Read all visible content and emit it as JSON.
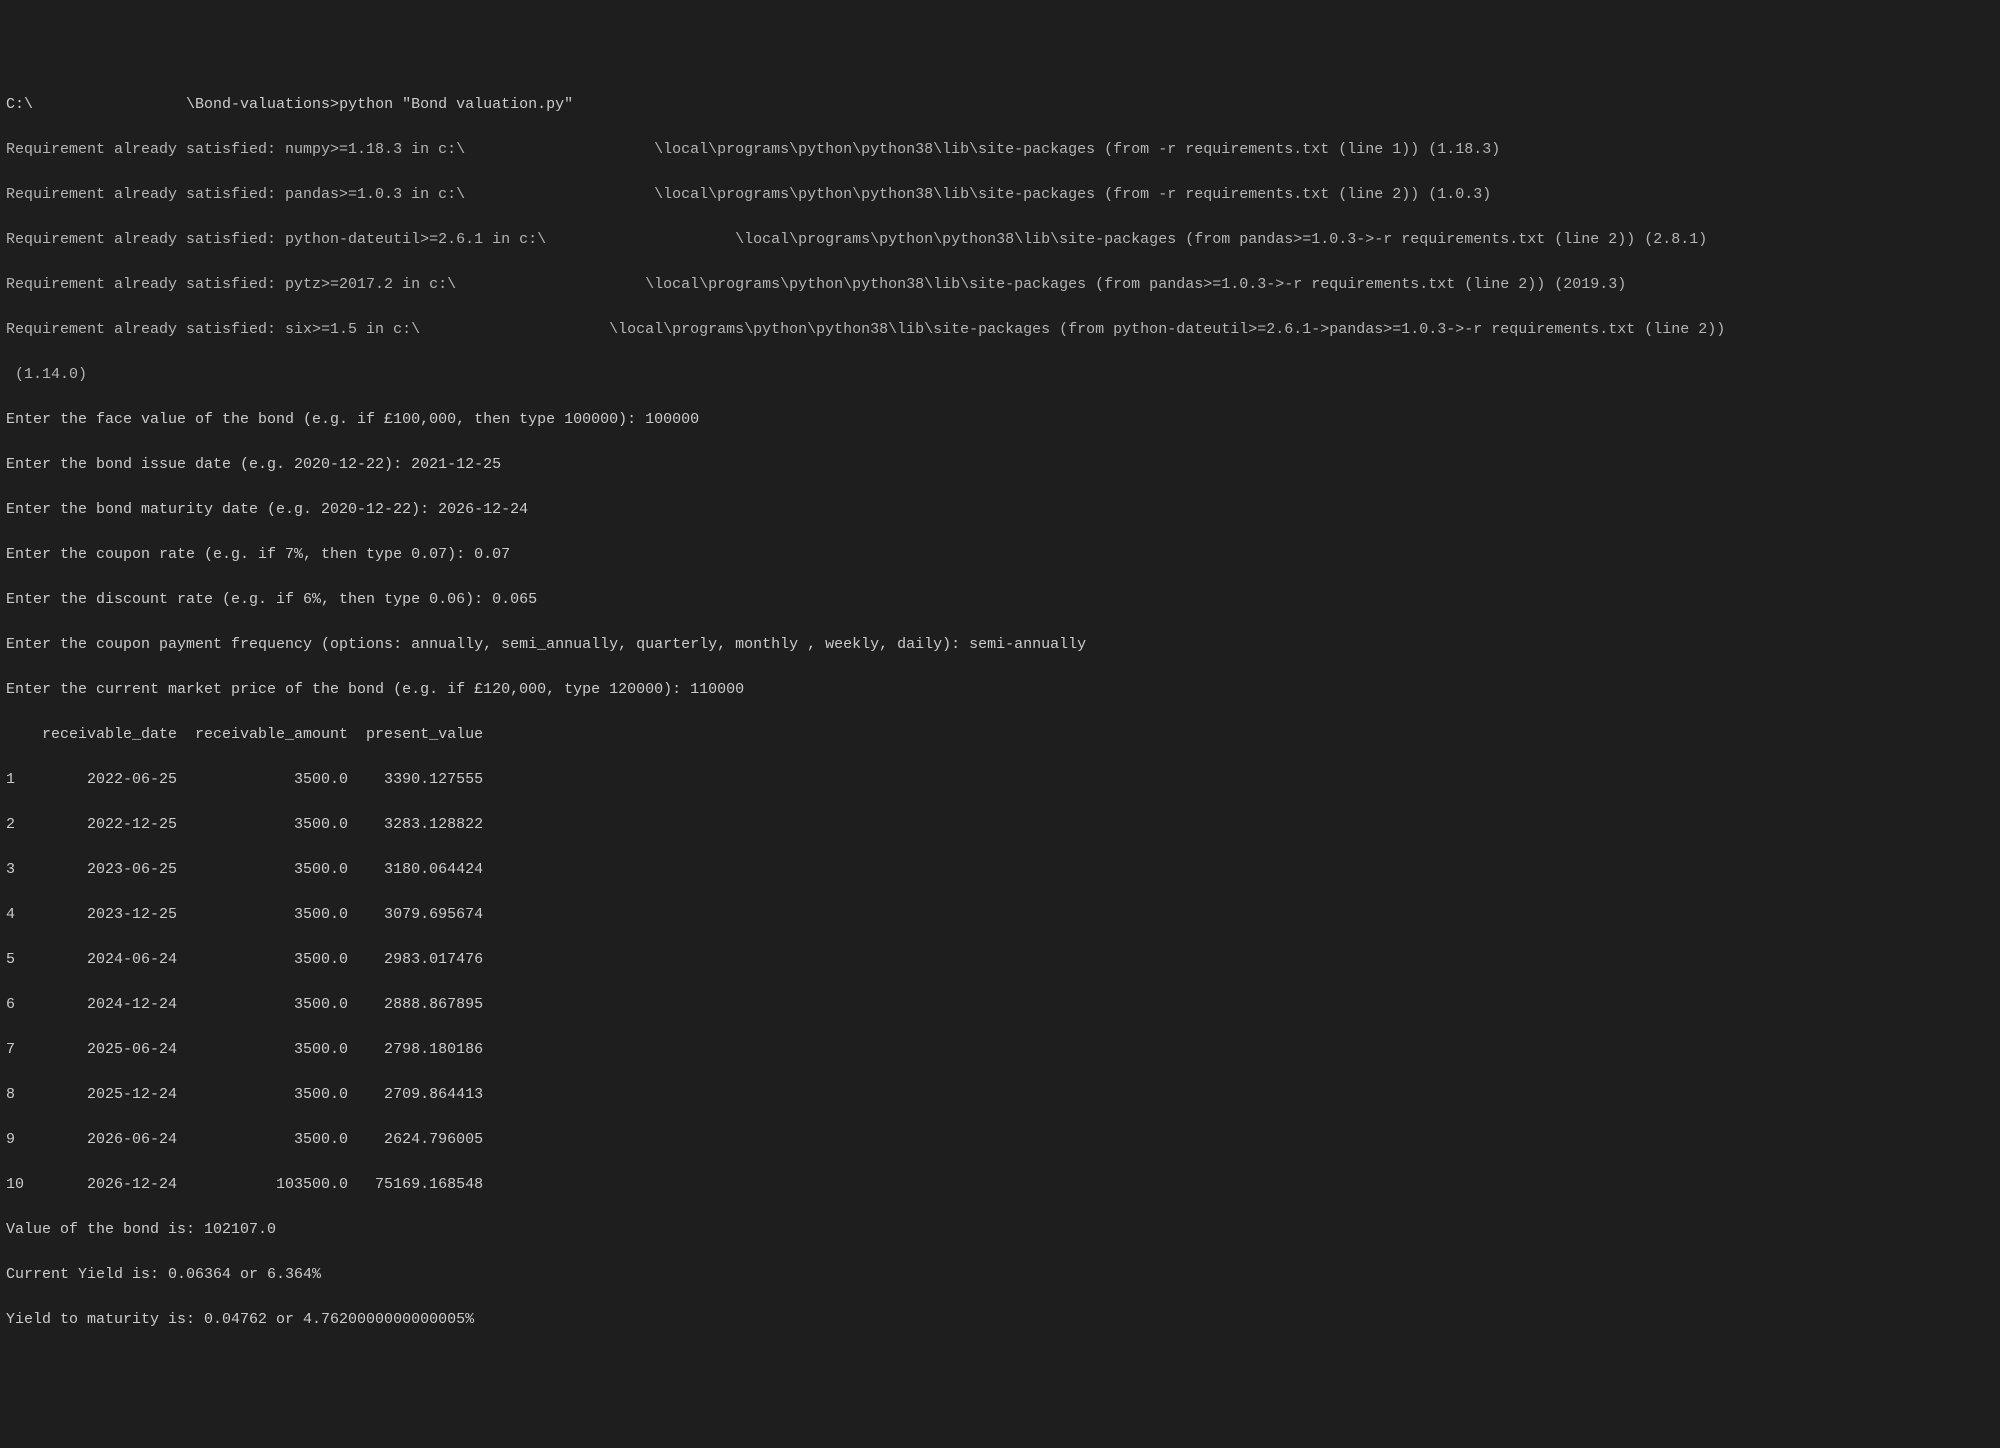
{
  "prompt": {
    "prefix": "C:\\                 \\Bond-valuations>",
    "command": "python \"Bond valuation.py\""
  },
  "requirements": [
    "Requirement already satisfied: numpy>=1.18.3 in c:\\                     \\local\\programs\\python\\python38\\lib\\site-packages (from -r requirements.txt (line 1)) (1.18.3)",
    "Requirement already satisfied: pandas>=1.0.3 in c:\\                     \\local\\programs\\python\\python38\\lib\\site-packages (from -r requirements.txt (line 2)) (1.0.3)",
    "Requirement already satisfied: python-dateutil>=2.6.1 in c:\\                     \\local\\programs\\python\\python38\\lib\\site-packages (from pandas>=1.0.3->-r requirements.txt (line 2)) (2.8.1)",
    "Requirement already satisfied: pytz>=2017.2 in c:\\                     \\local\\programs\\python\\python38\\lib\\site-packages (from pandas>=1.0.3->-r requirements.txt (line 2)) (2019.3)",
    "Requirement already satisfied: six>=1.5 in c:\\                     \\local\\programs\\python\\python38\\lib\\site-packages (from python-dateutil>=2.6.1->pandas>=1.0.3->-r requirements.txt (line 2))",
    " (1.14.0)"
  ],
  "inputs": [
    "Enter the face value of the bond (e.g. if £100,000, then type 100000): 100000",
    "Enter the bond issue date (e.g. 2020-12-22): 2021-12-25",
    "Enter the bond maturity date (e.g. 2020-12-22): 2026-12-24",
    "Enter the coupon rate (e.g. if 7%, then type 0.07): 0.07",
    "Enter the discount rate (e.g. if 6%, then type 0.06): 0.065",
    "Enter the coupon payment frequency (options: annually, semi_annually, quarterly, monthly , weekly, daily): semi-annually",
    "Enter the current market price of the bond (e.g. if £120,000, type 120000): 110000"
  ],
  "table": {
    "header": "    receivable_date  receivable_amount  present_value",
    "rows": [
      "1        2022-06-25             3500.0    3390.127555",
      "2        2022-12-25             3500.0    3283.128822",
      "3        2023-06-25             3500.0    3180.064424",
      "4        2023-12-25             3500.0    3079.695674",
      "5        2024-06-24             3500.0    2983.017476",
      "6        2024-12-24             3500.0    2888.867895",
      "7        2025-06-24             3500.0    2798.180186",
      "8        2025-12-24             3500.0    2709.864413",
      "9        2026-06-24             3500.0    2624.796005",
      "10       2026-12-24           103500.0   75169.168548"
    ]
  },
  "results": [
    "Value of the bond is: 102107.0",
    "Current Yield is: 0.06364 or 6.364%",
    "Yield to maturity is: 0.04762 or 4.7620000000000005%"
  ]
}
